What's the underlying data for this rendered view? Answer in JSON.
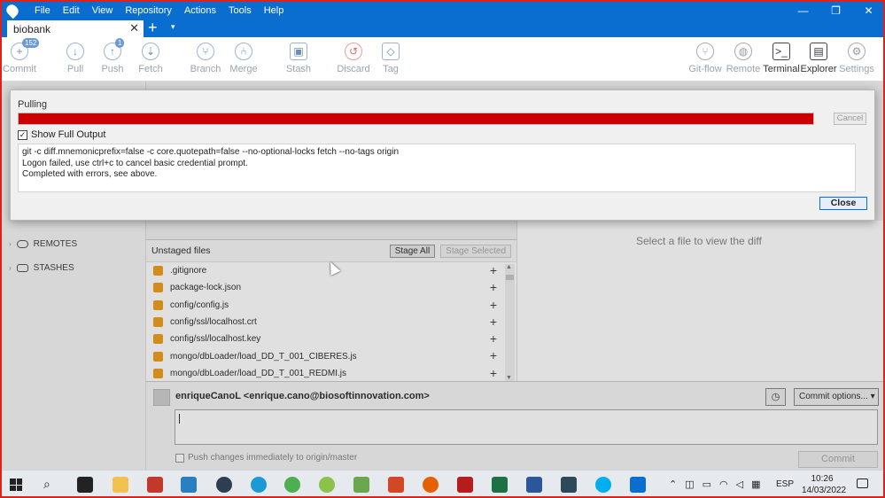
{
  "menu": [
    "File",
    "Edit",
    "View",
    "Repository",
    "Actions",
    "Tools",
    "Help"
  ],
  "window_controls": {
    "minimize": "—",
    "restore": "❐",
    "close": "✕"
  },
  "tab": {
    "label": "biobank",
    "close": "✕",
    "new": "+",
    "dropdown": "▾"
  },
  "toolbar": {
    "commit": {
      "label": "Commit",
      "badge": "152"
    },
    "pull": {
      "label": "Pull"
    },
    "push": {
      "label": "Push",
      "badge": "1"
    },
    "fetch": {
      "label": "Fetch"
    },
    "branch": {
      "label": "Branch"
    },
    "merge": {
      "label": "Merge"
    },
    "stash": {
      "label": "Stash"
    },
    "discard": {
      "label": "Discard"
    },
    "tag": {
      "label": "Tag"
    },
    "gitflow": {
      "label": "Git-flow"
    },
    "remote": {
      "label": "Remote"
    },
    "terminal": {
      "label": "Terminal"
    },
    "explorer": {
      "label": "Explorer"
    },
    "settings": {
      "label": "Settings"
    }
  },
  "sidebar": {
    "remotes": "REMOTES",
    "stashes": "STASHES"
  },
  "unstaged": {
    "title": "Unstaged files",
    "stage_all": "Stage All",
    "stage_selected": "Stage Selected",
    "files": [
      ".gitignore",
      "package-lock.json",
      "config/config.js",
      "config/ssl/localhost.crt",
      "config/ssl/localhost.key",
      "mongo/dbLoader/load_DD_T_001_CIBERES.js",
      "mongo/dbLoader/load_DD_T_001_REDMI.js"
    ]
  },
  "diff": {
    "placeholder": "Select a file to view the diff"
  },
  "commit": {
    "author": "enriqueCanoL <enrique.cano@biosoftinnovation.com>",
    "options": "Commit options... ▾",
    "push_immediately": "Push changes immediately to origin/master",
    "commit_button": "Commit"
  },
  "dialog": {
    "title": "Pulling",
    "progress": 1.0,
    "progress_color": "#cc0000",
    "cancel": "Cancel",
    "show_full_output": "Show Full Output",
    "show_full_output_checked": true,
    "output": [
      "git -c diff.mnemonicprefix=false -c core.quotepath=false --no-optional-locks fetch --no-tags origin",
      "Logon failed, use ctrl+c to cancel basic credential prompt.",
      "Completed with errors, see above."
    ],
    "close": "Close"
  },
  "taskbar": {
    "language": "ESP",
    "time": "10:26",
    "date": "14/03/2022"
  }
}
